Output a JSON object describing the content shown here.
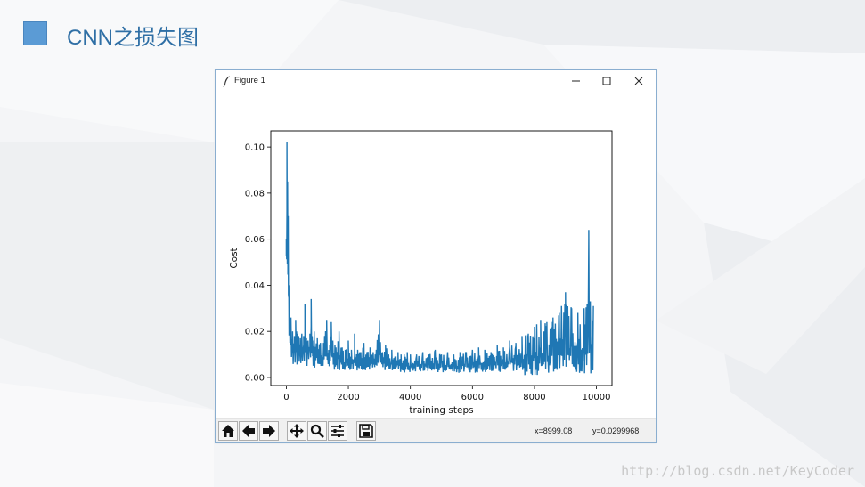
{
  "slide": {
    "title": "CNN之损失图",
    "watermark": "http://blog.csdn.net/KeyCoder"
  },
  "window": {
    "title": "Figure 1",
    "controls": {
      "minimize_icon": "minimize-icon",
      "maximize_icon": "maximize-icon",
      "close_icon": "close-icon"
    }
  },
  "toolbar": {
    "buttons": [
      {
        "name": "home-button",
        "icon": "home-icon"
      },
      {
        "name": "back-button",
        "icon": "arrow-left-icon"
      },
      {
        "name": "forward-button",
        "icon": "arrow-right-icon"
      },
      {
        "name": "pan-button",
        "icon": "move-icon"
      },
      {
        "name": "zoom-button",
        "icon": "zoom-icon"
      },
      {
        "name": "configure-subplots-button",
        "icon": "sliders-icon"
      },
      {
        "name": "save-button",
        "icon": "save-icon"
      }
    ],
    "x_readout": "x=8999.08",
    "y_readout": "y=0.0299968"
  },
  "chart_data": {
    "type": "line",
    "title": "",
    "xlabel": "training steps",
    "ylabel": "Cost",
    "xlim": [
      -500,
      10500
    ],
    "ylim": [
      -0.0035,
      0.107
    ],
    "xticks": [
      0,
      2000,
      4000,
      6000,
      8000,
      10000
    ],
    "ytick_values": [
      0.0,
      0.02,
      0.04,
      0.06,
      0.08,
      0.1
    ],
    "ytick_labels": [
      "0.00",
      "0.02",
      "0.04",
      "0.06",
      "0.08",
      "0.10"
    ],
    "grid": false,
    "series_color": "#1f77b4",
    "series": [
      {
        "x": [
          0,
          20,
          40,
          60,
          80,
          100,
          150,
          200,
          260,
          300,
          330,
          360,
          400,
          450,
          500,
          560,
          600,
          650,
          700,
          760,
          800,
          850,
          900,
          1000,
          1100,
          1200,
          1300,
          1400,
          1450,
          1500,
          1600,
          1700,
          1800,
          1900,
          2000,
          2100,
          2200,
          2300,
          2400,
          2500,
          2600,
          2700,
          2800,
          2900,
          3000,
          3100,
          3200,
          3300,
          3400,
          3500,
          3600,
          3700,
          3800,
          3900,
          4000,
          4200,
          4400,
          4600,
          4800,
          5000,
          5200,
          5400,
          5600,
          5800,
          6000,
          6200,
          6400,
          6600,
          6800,
          7000,
          7200,
          7400,
          7600,
          7800,
          8000,
          8200,
          8400,
          8600,
          8800,
          9000,
          9200,
          9400,
          9600,
          9700,
          9750,
          9800,
          9900
        ],
        "y_high": [
          0.06,
          0.102,
          0.085,
          0.07,
          0.04,
          0.035,
          0.026,
          0.02,
          0.018,
          0.025,
          0.02,
          0.019,
          0.018,
          0.017,
          0.019,
          0.018,
          0.032,
          0.017,
          0.016,
          0.019,
          0.034,
          0.016,
          0.02,
          0.017,
          0.015,
          0.015,
          0.025,
          0.014,
          0.024,
          0.016,
          0.013,
          0.02,
          0.013,
          0.012,
          0.016,
          0.012,
          0.019,
          0.012,
          0.011,
          0.015,
          0.011,
          0.013,
          0.011,
          0.012,
          0.025,
          0.011,
          0.014,
          0.01,
          0.012,
          0.009,
          0.011,
          0.01,
          0.01,
          0.011,
          0.01,
          0.01,
          0.011,
          0.01,
          0.012,
          0.01,
          0.011,
          0.01,
          0.011,
          0.011,
          0.012,
          0.013,
          0.012,
          0.011,
          0.014,
          0.013,
          0.016,
          0.015,
          0.018,
          0.019,
          0.022,
          0.025,
          0.024,
          0.026,
          0.028,
          0.037,
          0.03,
          0.028,
          0.03,
          0.032,
          0.064,
          0.033,
          0.031
        ],
        "y_low": [
          0.038,
          0.05,
          0.04,
          0.035,
          0.02,
          0.01,
          0.006,
          0.005,
          0.005,
          0.006,
          0.005,
          0.005,
          0.005,
          0.005,
          0.005,
          0.005,
          0.005,
          0.005,
          0.004,
          0.004,
          0.004,
          0.004,
          0.004,
          0.004,
          0.004,
          0.004,
          0.004,
          0.004,
          0.004,
          0.003,
          0.003,
          0.003,
          0.003,
          0.003,
          0.003,
          0.003,
          0.003,
          0.003,
          0.003,
          0.003,
          0.003,
          0.003,
          0.003,
          0.003,
          0.003,
          0.003,
          0.003,
          0.003,
          0.003,
          0.003,
          0.003,
          0.002,
          0.002,
          0.002,
          0.002,
          0.002,
          0.002,
          0.002,
          0.002,
          0.002,
          0.002,
          0.002,
          0.002,
          0.002,
          0.002,
          0.002,
          0.002,
          0.002,
          0.002,
          0.002,
          0.002,
          0.001,
          0.001,
          0.001,
          0.001,
          0.001,
          0.001,
          0.001,
          0.001,
          0.001,
          0.001,
          0.001,
          0.001,
          0.001,
          0.001,
          0.001,
          0.001
        ]
      }
    ]
  }
}
